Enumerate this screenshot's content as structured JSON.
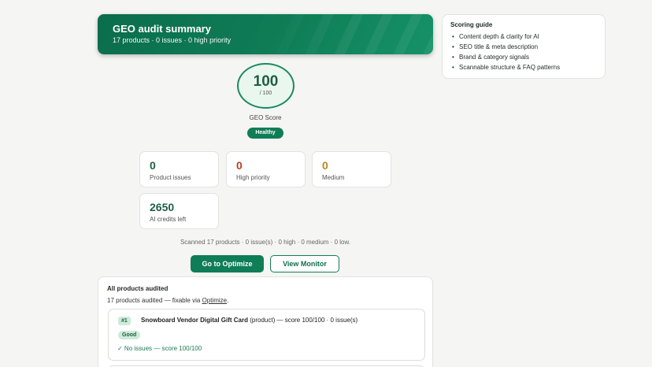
{
  "hero": {
    "title": "GEO audit summary",
    "subtitle": "17 products · 0 issues · 0 high priority",
    "accent": "#0f7d57"
  },
  "guide": {
    "title": "Scoring guide",
    "items": [
      "Content depth & clarity for AI",
      "SEO title & meta description",
      "Brand & category signals",
      "Scannable structure & FAQ patterns"
    ]
  },
  "score": {
    "value": "100",
    "max": "/ 100",
    "label": "GEO Score",
    "status": "Healthy"
  },
  "stats": [
    {
      "value": "0",
      "label": "Product issues",
      "color": "#1f5e45"
    },
    {
      "value": "0",
      "label": "High priority",
      "color": "#b5431f"
    },
    {
      "value": "0",
      "label": "Medium",
      "color": "#b7891a"
    },
    {
      "value": "2650",
      "label": "AI credits left",
      "color": "#1f5e45"
    }
  ],
  "scan_summary": "Scanned 17 products · 0 issue(s) · 0 high · 0 medium · 0 low.",
  "actions": {
    "primary": "Go to Optimize",
    "secondary": "View Monitor"
  },
  "audit": {
    "title": "All products audited",
    "subtitle_prefix": "17 products audited — fixable via ",
    "subtitle_link": "Optimize",
    "subtitle_suffix": ".",
    "products": [
      {
        "rank": "#1",
        "name": "Snowboard Vendor Digital Gift Card",
        "details": " (product) — score 100/100 · 0 issue(s)",
        "badge": "Good",
        "note": "✓ No issues — score 100/100"
      }
    ]
  }
}
